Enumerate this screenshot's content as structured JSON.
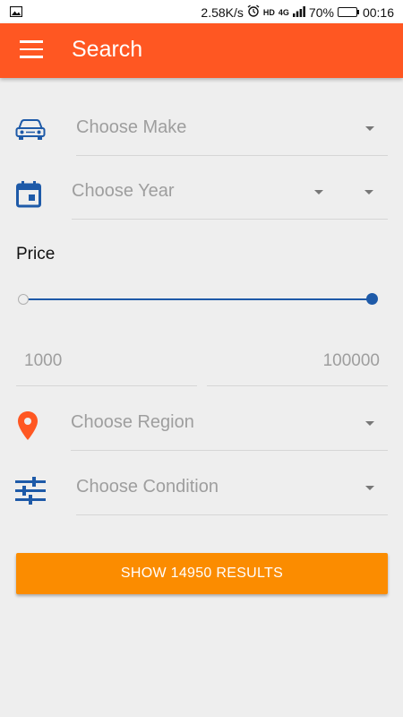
{
  "status_bar": {
    "speed": "2.58K/s",
    "network_type": "4G",
    "hd_label": "HD",
    "battery_percent": "70%",
    "battery_level": 0.7,
    "time": "00:16",
    "icons": [
      "image-icon",
      "alarm-icon",
      "signal-icon",
      "battery-icon"
    ]
  },
  "app_bar": {
    "title": "Search",
    "menu_icon": "hamburger-menu-icon"
  },
  "colors": {
    "app_bar": "#ff5722",
    "accent_blue": "#1e5aa8",
    "button": "#fb8c00",
    "location_pin": "#ff5722"
  },
  "form": {
    "make": {
      "placeholder": "Choose Make",
      "icon": "car-icon"
    },
    "year": {
      "placeholder": "Choose Year",
      "icon": "calendar-icon"
    },
    "price": {
      "label": "Price",
      "min": "1000",
      "max": "100000",
      "slider_low": 0.0,
      "slider_high": 1.0
    },
    "region": {
      "placeholder": "Choose Region",
      "icon": "location-pin-icon"
    },
    "condition": {
      "placeholder": "Choose Condition",
      "icon": "sliders-icon"
    }
  },
  "submit": {
    "label": "SHOW 14950 RESULTS"
  }
}
